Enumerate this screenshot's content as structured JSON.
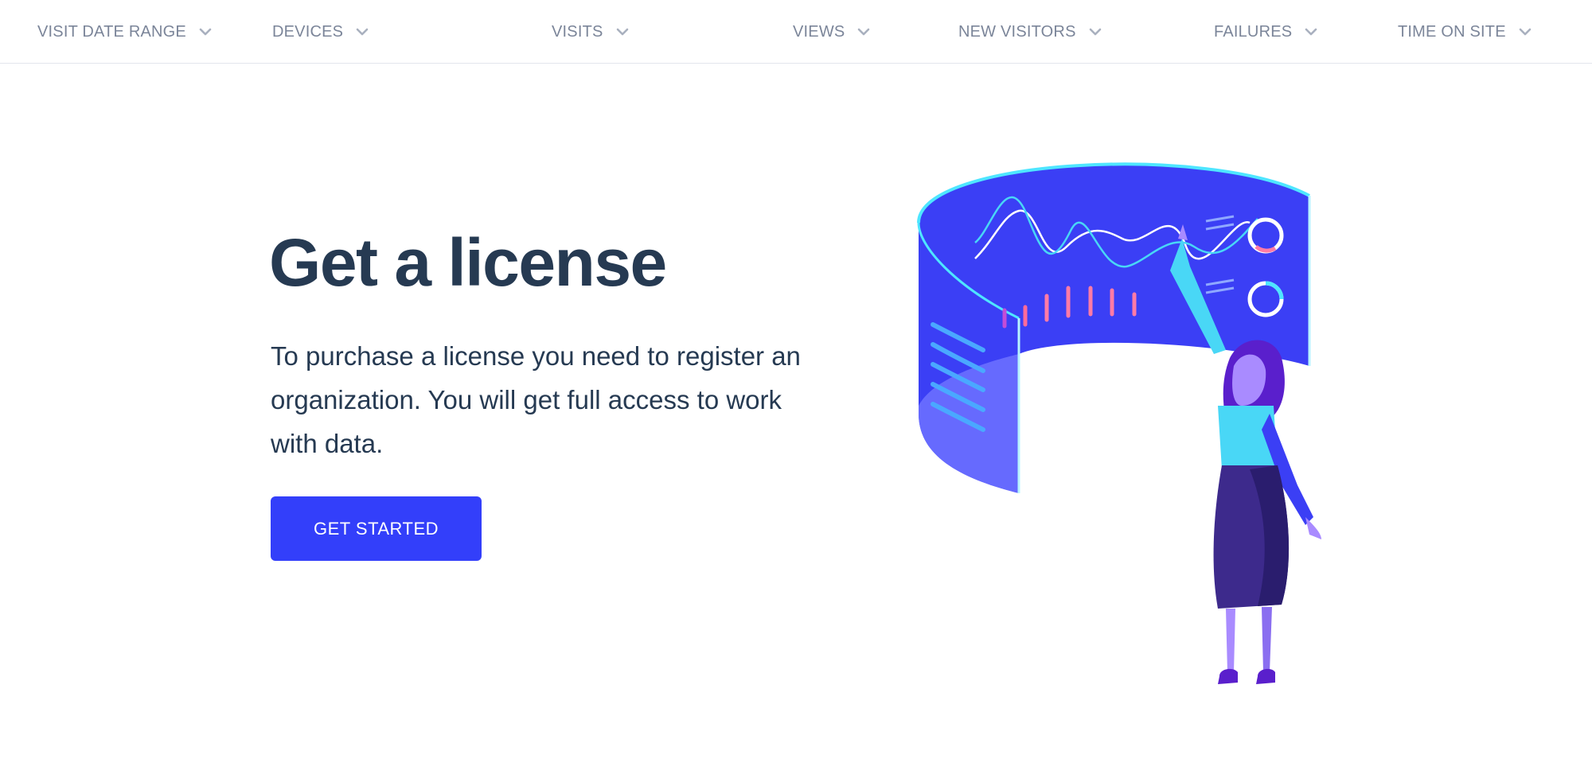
{
  "filters": [
    {
      "label": "VISIT DATE RANGE"
    },
    {
      "label": "DEVICES"
    },
    {
      "label": "VISITS"
    },
    {
      "label": "VIEWS"
    },
    {
      "label": "NEW VISITORS"
    },
    {
      "label": "FAILURES"
    },
    {
      "label": "TIME ON SITE"
    }
  ],
  "hero": {
    "title": "Get a license",
    "description": "To purchase a license you need to register an organization. You will get full access to work with data.",
    "cta_label": "GET STARTED"
  },
  "icons": {
    "filter_chevron": "chevron-down-icon",
    "illustration": "analytics-dashboard-illustration"
  },
  "colors": {
    "accent": "#333ffa",
    "title": "#263a52",
    "filter_text": "#7b8599"
  }
}
